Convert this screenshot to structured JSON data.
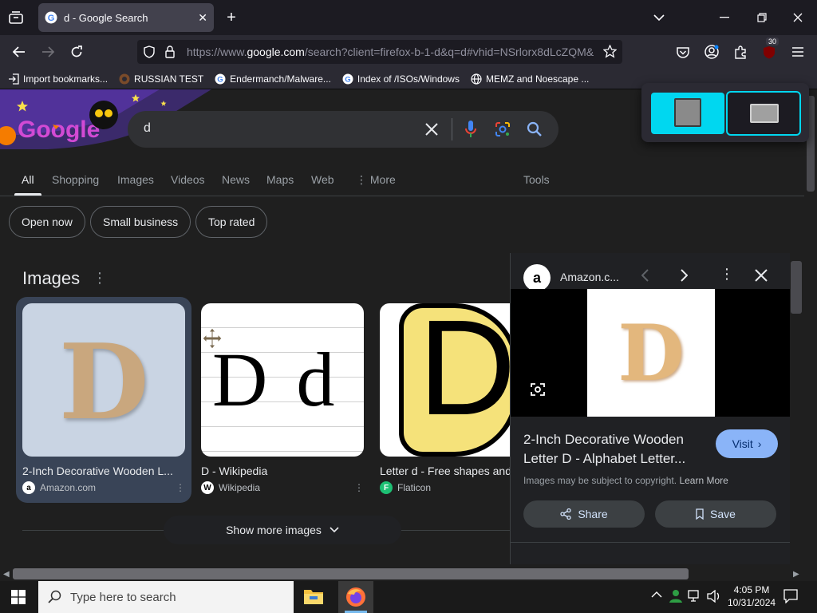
{
  "browser": {
    "tab_title": "d - Google Search",
    "url_prefix": "https://www.",
    "url_host": "google.com",
    "url_rest": "/search?client=firefox-b-1-d&q=d#vhid=NSrlorx8dLcZQM&",
    "extension_badge": "30",
    "bookmarks": [
      {
        "label": "Import bookmarks...",
        "icon": "import-icon"
      },
      {
        "label": "RUSSIAN TEST",
        "icon": "github-icon"
      },
      {
        "label": "Endermanch/Malware...",
        "icon": "google-icon"
      },
      {
        "label": "Index of /ISOs/Windows",
        "icon": "google-icon"
      },
      {
        "label": "MEMZ and Noescape ...",
        "icon": "globe-icon"
      }
    ]
  },
  "search": {
    "query": "d",
    "tabs": [
      "All",
      "Shopping",
      "Images",
      "Videos",
      "News",
      "Maps",
      "Web",
      "More"
    ],
    "tools": "Tools",
    "chips": [
      "Open now",
      "Small business",
      "Top rated"
    ]
  },
  "images_section": {
    "title": "Images",
    "cards": [
      {
        "caption": "2-Inch Decorative Wooden L...",
        "source": "Amazon.com",
        "letter": "D"
      },
      {
        "caption": "D - Wikipedia",
        "source": "Wikipedia",
        "letter": "D d"
      },
      {
        "caption": "Letter d - Free shapes and",
        "source": "Flaticon",
        "letter": "D"
      }
    ],
    "show_more": "Show more images"
  },
  "panel": {
    "site": "Amazon.c...",
    "title": "2-Inch Decorative Wooden Letter D - Alphabet Letter...",
    "visit": "Visit",
    "copyright": "Images may be subject to copyright.",
    "learn_more": "Learn More",
    "share": "Share",
    "save": "Save",
    "image_letter": "D"
  },
  "taskbar": {
    "search_placeholder": "Type here to search",
    "time": "4:05 PM",
    "date": "10/31/2024"
  },
  "colors": {
    "accent_blue": "#8ab4f8",
    "visit_bg": "#8ab4f8",
    "selected_card": "#394457",
    "popup_cyan": "#00d7f0"
  }
}
